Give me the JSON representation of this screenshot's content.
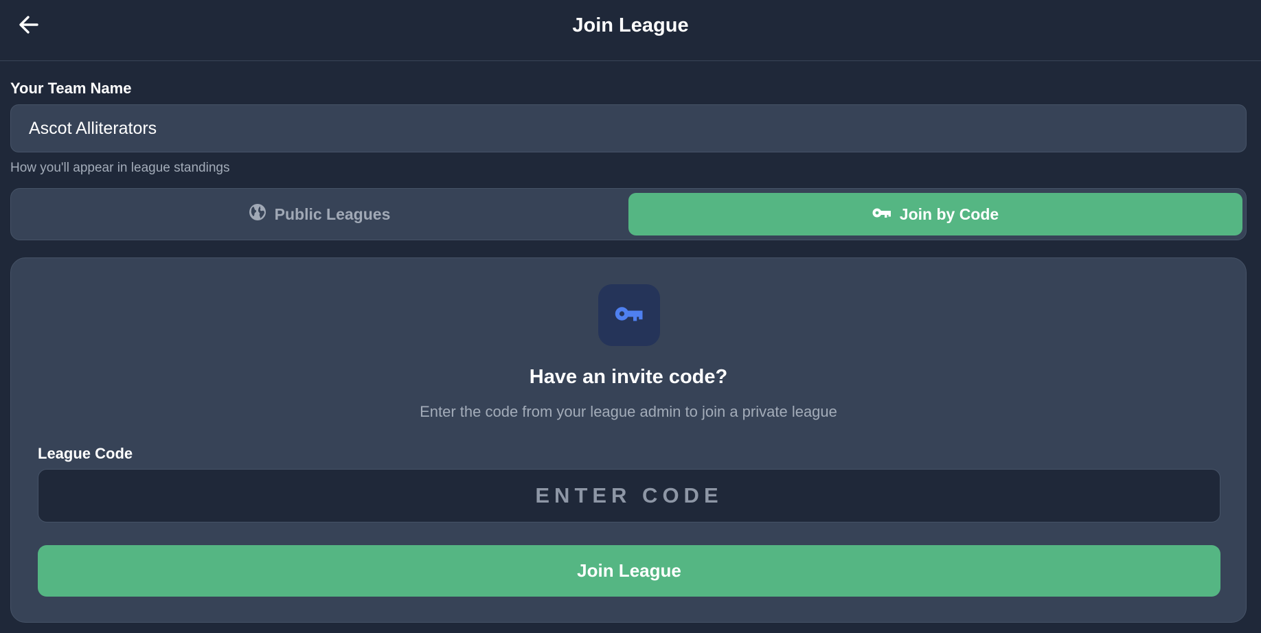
{
  "header": {
    "title": "Join League",
    "back_icon": "arrow-left-icon"
  },
  "team": {
    "label": "Your Team Name",
    "value": "Ascot Alliterators",
    "helper": "How you'll appear in league standings"
  },
  "tabs": [
    {
      "label": "Public Leagues",
      "icon": "globe-icon",
      "active": false
    },
    {
      "label": "Join by Code",
      "icon": "key-icon",
      "active": true
    }
  ],
  "invite": {
    "icon": "key-icon",
    "heading": "Have an invite code?",
    "subtext": "Enter the code from your league admin to join a private league",
    "code_label": "League Code",
    "code_placeholder": "ENTER CODE",
    "code_value": "",
    "submit_label": "Join League"
  },
  "colors": {
    "background": "#1f2839",
    "surface": "#374357",
    "accent_green": "#55b683",
    "key_blue": "#4f80f0",
    "muted_text": "#a3acb9"
  }
}
